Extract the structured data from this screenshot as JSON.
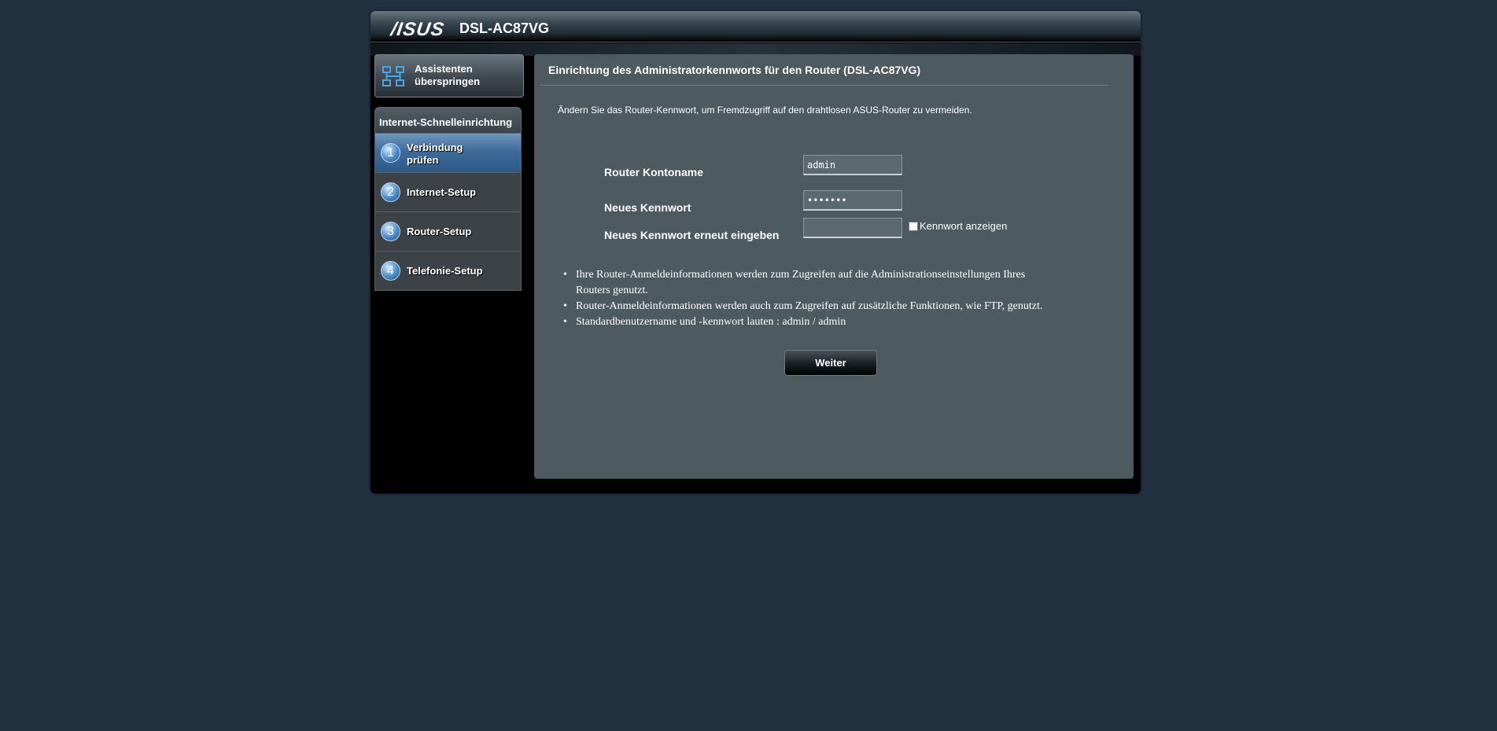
{
  "header": {
    "brand": "/ISUS",
    "model": "DSL-AC87VG"
  },
  "sidebar": {
    "skip_button": "Assistenten\nüberspringen",
    "skip_icon": "network-icon",
    "wizard_title": "Internet-Schnelleinrichtung",
    "steps": [
      {
        "number": "1",
        "label": "Verbindung\nprüfen",
        "active": true
      },
      {
        "number": "2",
        "label": "Internet-Setup",
        "active": false
      },
      {
        "number": "3",
        "label": "Router-Setup",
        "active": false
      },
      {
        "number": "4",
        "label": "Telefonie-Setup",
        "active": false
      }
    ]
  },
  "main": {
    "title": "Einrichtung des Administratorkennworts für den Router (DSL-AC87VG)",
    "intro": "Ändern Sie das Router-Kennwort, um Fremdzugriff auf den drahtlosen ASUS-Router zu vermeiden.",
    "fields": {
      "account_label": "Router Kontoname",
      "account_value": "admin",
      "new_pw_label": "Neues Kennwort",
      "new_pw_value": "•••••••",
      "confirm_pw_label": "Neues Kennwort erneut eingeben",
      "confirm_pw_value": ""
    },
    "show_password_label": "Kennwort anzeigen",
    "show_password_checked": false,
    "notes": [
      "Ihre Router-Anmeldeinformationen werden zum Zugreifen auf die Administrationseinstellungen Ihres Routers genutzt.",
      "Router-Anmeldeinformationen werden auch zum Zugreifen auf zusätzliche Funktionen, wie FTP, genutzt.",
      "Standardbenutzername und -kennwort lauten : admin / admin"
    ],
    "next_button": "Weiter"
  },
  "colors": {
    "page_bg": "#21313f",
    "panel_bg": "#4d5a5f",
    "active_step": "#3e6b9a"
  }
}
